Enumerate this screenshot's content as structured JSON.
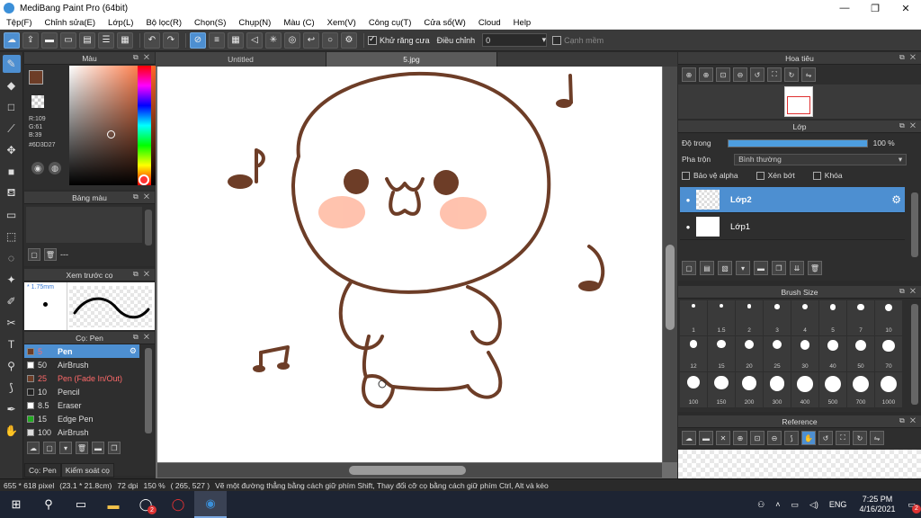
{
  "window": {
    "title": "MediBang Paint Pro (64bit)",
    "minimize": "—",
    "maximize": "❐",
    "close": "✕"
  },
  "menu": [
    "Tệp(F)",
    "Chỉnh sửa(E)",
    "Lớp(L)",
    "Bộ lọc(R)",
    "Chọn(S)",
    "Chụp(N)",
    "Màu (C)",
    "Xem(V)",
    "Công cụ(T)",
    "Cửa sổ(W)",
    "Cloud",
    "Help"
  ],
  "toolbar": {
    "antialias_label": "Khử răng cưa",
    "adjust_label": "Điều chỉnh",
    "adjust_value": "0",
    "smooth_label": "Cạnh mềm"
  },
  "color_panel": {
    "title": "Màu",
    "r": "R:109",
    "g": "G:61",
    "b": "B:39",
    "hex": "#6D3D27",
    "foreground_color": "#6D3D27"
  },
  "palette_panel": {
    "title": "Bảng màu",
    "name": "---"
  },
  "brush_preview": {
    "title": "Xem trước cọ",
    "size": "1.75mm"
  },
  "brush_panel": {
    "title": "Cọ: Pen",
    "brushes": [
      {
        "size": "5",
        "name": "Pen",
        "color": "#6D3D27"
      },
      {
        "size": "50",
        "name": "AirBrush",
        "color": "#ffffff"
      },
      {
        "size": "25",
        "name": "Pen (Fade In/Out)",
        "color": "#6D3D27"
      },
      {
        "size": "10",
        "name": "Pencil",
        "color": "#222222"
      },
      {
        "size": "8.5",
        "name": "Eraser",
        "color": "#ffffff"
      },
      {
        "size": "15",
        "name": "Edge Pen",
        "color": "#22aa22"
      },
      {
        "size": "100",
        "name": "AirBrush",
        "color": "#dddddd"
      }
    ],
    "tabs": [
      "Cọ: Pen",
      "Kiểm soát cọ"
    ]
  },
  "canvas": {
    "tabs": [
      "Untitled",
      "5.jpg"
    ]
  },
  "navigator": {
    "title": "Hoa tiêu"
  },
  "layers": {
    "title": "Lớp",
    "opacity_label": "Độ trong",
    "opacity_value": "100 %",
    "opacity": 1.0,
    "blend_label": "Pha trộn",
    "blend_value": "Bình thường",
    "protect_alpha": "Bảo vệ alpha",
    "clipping": "Xén bớt",
    "lock": "Khóa",
    "items": [
      "Lớp2",
      "Lớp1"
    ]
  },
  "brush_size": {
    "title": "Brush Size",
    "sizes": [
      "1",
      "1.5",
      "2",
      "3",
      "4",
      "5",
      "7",
      "10",
      "12",
      "15",
      "20",
      "25",
      "30",
      "40",
      "50",
      "70",
      "100",
      "150",
      "200",
      "300",
      "400",
      "500",
      "700",
      "1000"
    ]
  },
  "reference": {
    "title": "Reference"
  },
  "status": {
    "pixels": "655 * 618 pixel",
    "physical": "(23.1 * 21.8cm)",
    "dpi": "72 dpi",
    "zoom": "150 %",
    "coords": "( 265, 527 )",
    "hint": "Vẽ một đường thẳng bằng cách giữ phím Shift, Thay đổi cỡ cọ bằng cách giữ phím Ctrl, Alt và kéo"
  },
  "taskbar": {
    "lang": "ENG",
    "time": "7:25 PM",
    "date": "4/16/2021",
    "notif_count": "2",
    "chat_badge": "2"
  }
}
